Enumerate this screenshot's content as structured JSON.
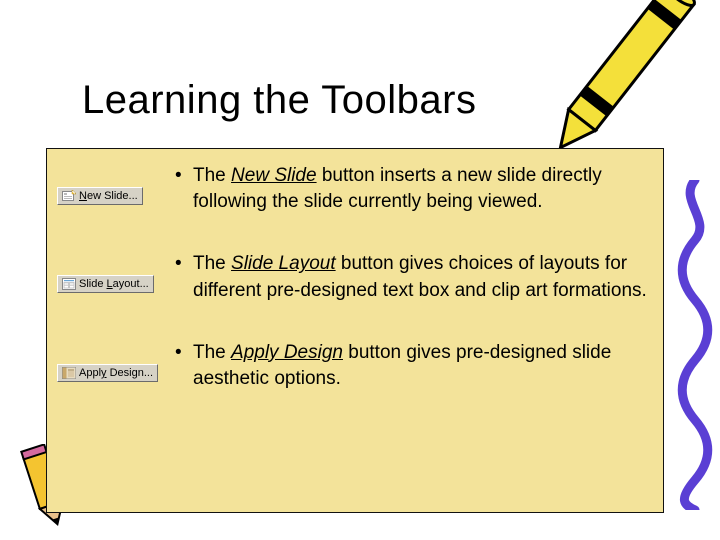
{
  "title": "Learning the Toolbars",
  "items": [
    {
      "button": {
        "pre": "",
        "u": "N",
        "post": "ew Slide..."
      },
      "desc": {
        "before": "The ",
        "term": "New Slide",
        "after": " button inserts a new slide directly following the slide currently being viewed."
      }
    },
    {
      "button": {
        "pre": "Slide ",
        "u": "L",
        "post": "ayout..."
      },
      "desc": {
        "before": "The ",
        "term": "Slide Layout",
        "after": " button gives choices of layouts for different pre-designed text box and clip art formations."
      }
    },
    {
      "button": {
        "pre": "Appl",
        "u": "y",
        "post": " Design..."
      },
      "desc": {
        "before": "The ",
        "term": "Apply Design",
        "after": " button gives pre-designed slide aesthetic options."
      }
    }
  ]
}
